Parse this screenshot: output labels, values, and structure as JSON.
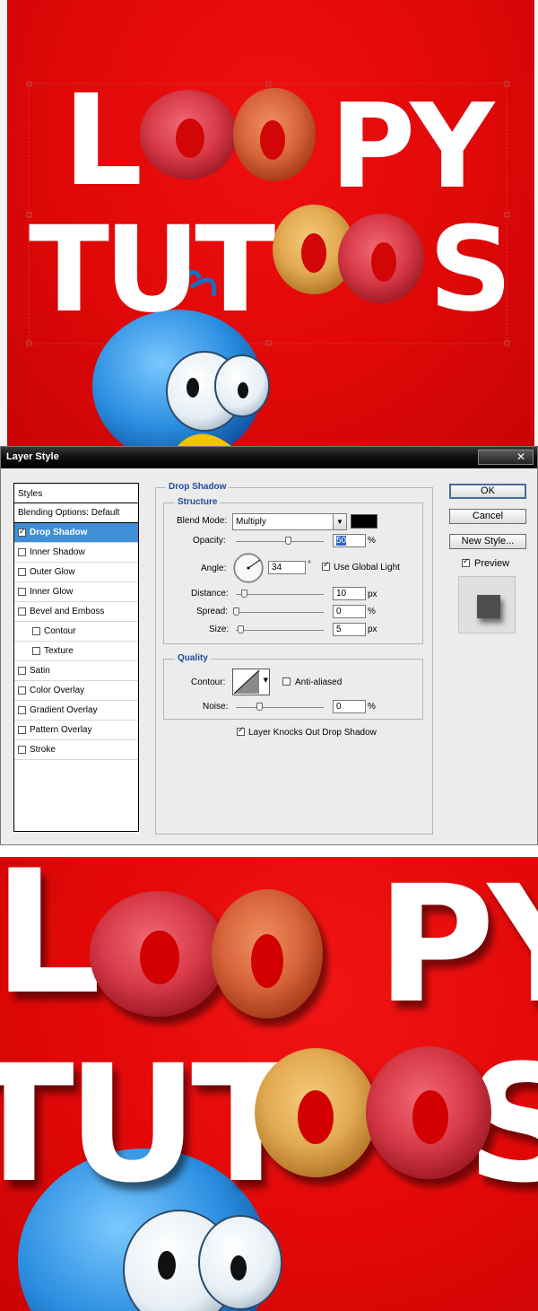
{
  "artwork": {
    "line1_left": "L",
    "line1_right": "PY",
    "line2_left": "TUT",
    "line2_right": "S"
  },
  "dialog": {
    "title": "Layer Style",
    "close_glyph": "✕",
    "styles_header": "Styles",
    "blending_options": "Blending Options: Default",
    "style_items": [
      {
        "label": "Drop Shadow",
        "checked": true
      },
      {
        "label": "Inner Shadow",
        "checked": false
      },
      {
        "label": "Outer Glow",
        "checked": false
      },
      {
        "label": "Inner Glow",
        "checked": false
      },
      {
        "label": "Bevel and Emboss",
        "checked": false
      },
      {
        "label": "Contour",
        "checked": false
      },
      {
        "label": "Texture",
        "checked": false
      },
      {
        "label": "Satin",
        "checked": false
      },
      {
        "label": "Color Overlay",
        "checked": false
      },
      {
        "label": "Gradient Overlay",
        "checked": false
      },
      {
        "label": "Pattern Overlay",
        "checked": false
      },
      {
        "label": "Stroke",
        "checked": false
      }
    ],
    "section_title": "Drop Shadow",
    "structure": {
      "title": "Structure",
      "blend_mode_label": "Blend Mode:",
      "blend_mode_value": "Multiply",
      "shadow_color": "#000000",
      "opacity_label": "Opacity:",
      "opacity_value": "50",
      "opacity_unit": "%",
      "opacity_fraction": 0.5,
      "angle_label": "Angle:",
      "angle_value": "34",
      "angle_unit": "°",
      "use_global_light_label": "Use Global Light",
      "use_global_light_checked": true,
      "distance_label": "Distance:",
      "distance_value": "10",
      "distance_unit": "px",
      "spread_label": "Spread:",
      "spread_value": "0",
      "spread_unit": "%",
      "size_label": "Size:",
      "size_value": "5",
      "size_unit": "px"
    },
    "quality": {
      "title": "Quality",
      "contour_label": "Contour:",
      "anti_aliased_label": "Anti-aliased",
      "anti_aliased_checked": false,
      "noise_label": "Noise:",
      "noise_value": "0",
      "noise_unit": "%"
    },
    "knocks_out_label": "Layer Knocks Out Drop Shadow",
    "knocks_out_checked": true,
    "buttons": {
      "ok": "OK",
      "cancel": "Cancel",
      "new_style": "New Style...",
      "preview_label": "Preview",
      "preview_checked": true
    }
  },
  "colors": {
    "canvas_red": "#e00808",
    "selection_blue": "#3f8ed6",
    "group_title_blue": "#1c4c9c",
    "ring_red": "#d83a48",
    "ring_orange": "#d8643a",
    "ring_yellow": "#e2aa52",
    "bird_blue": "#2a8ee0"
  }
}
